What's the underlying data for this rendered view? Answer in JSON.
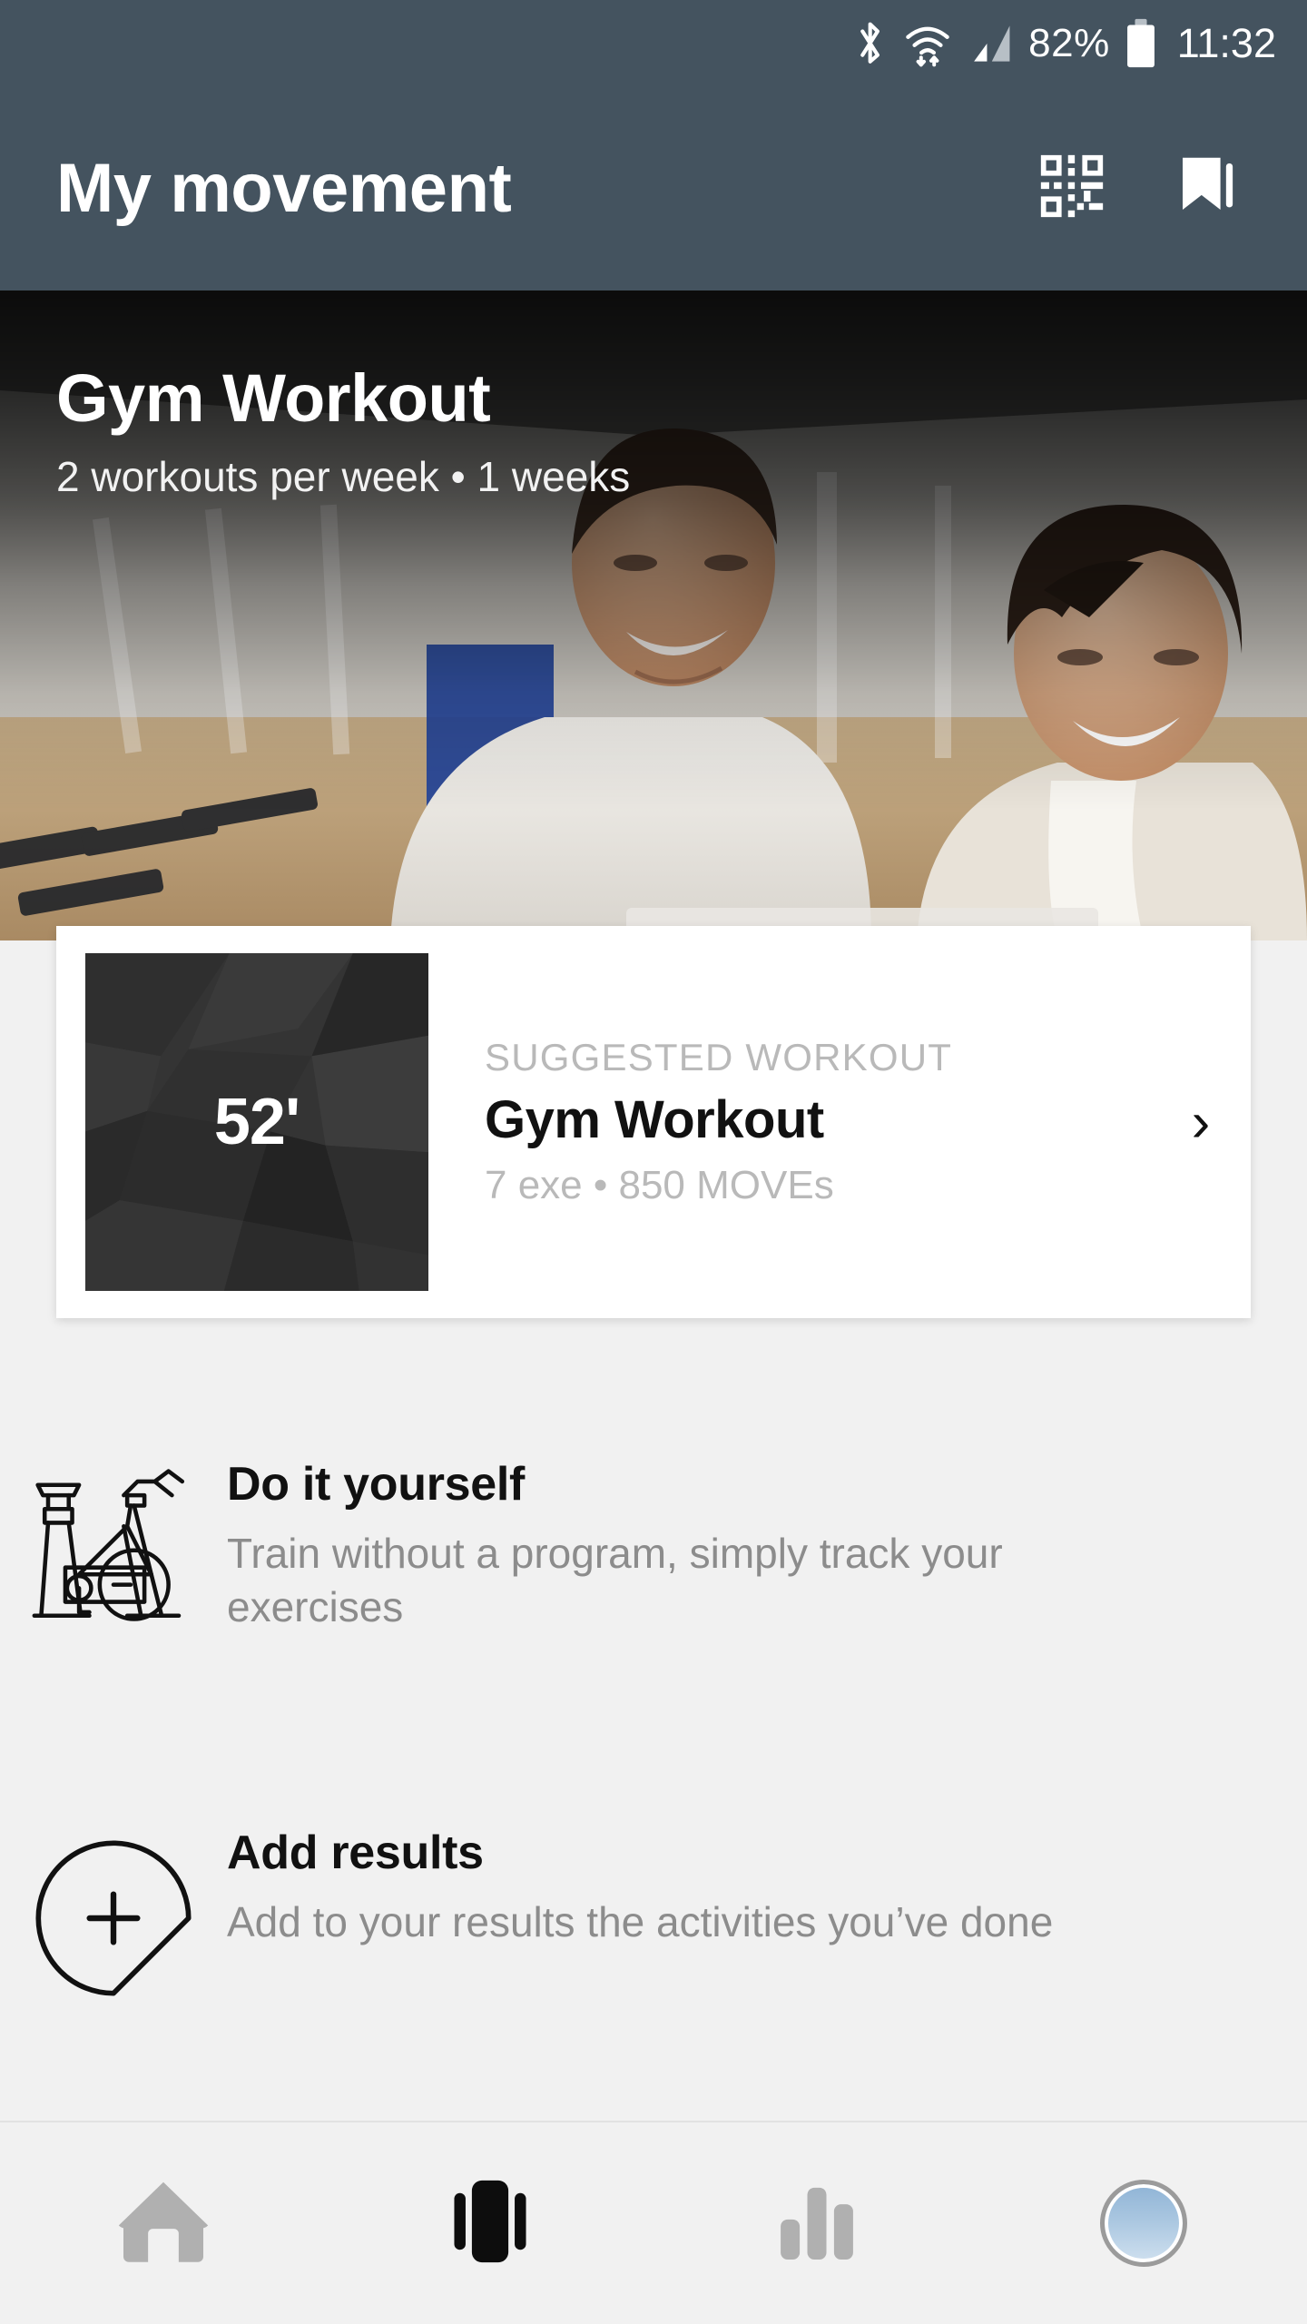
{
  "statusbar": {
    "bluetooth_icon": "bluetooth-icon",
    "wifi_icon": "wifi-icon",
    "signal_icon": "cellular-signal-icon",
    "battery_percent": "82%",
    "battery_icon": "battery-icon",
    "clock": "11:32"
  },
  "appbar": {
    "title": "My movement",
    "scan_icon": "qr-scan-icon",
    "bookmark_icon": "bookmark-icon"
  },
  "hero": {
    "title": "Gym Workout",
    "subtitle": "2 workouts per week • 1 weeks"
  },
  "suggested_card": {
    "duration": "52'",
    "kicker": "SUGGESTED WORKOUT",
    "title": "Gym Workout",
    "meta": "7 exe • 850 MOVEs",
    "chevron": "›"
  },
  "actions": [
    {
      "icon": "exercise-bike-icon",
      "title": "Do it yourself",
      "description": "Train without a program, simply track your exercises"
    },
    {
      "icon": "add-pin-icon",
      "title": "Add results",
      "description": "Add to your results the activities you’ve done"
    }
  ],
  "bottomnav": {
    "items": [
      {
        "icon": "home-icon",
        "active": false
      },
      {
        "icon": "workout-cards-icon",
        "active": true
      },
      {
        "icon": "stats-bars-icon",
        "active": false
      },
      {
        "icon": "profile-avatar-icon",
        "active": false
      }
    ]
  },
  "colors": {
    "header": "#44535f",
    "background": "#f1f1f1",
    "card": "#ffffff",
    "muted_text": "#8c8c8c",
    "kicker_text": "#b9b9b9",
    "primary_text": "#111111",
    "nav_inactive": "#b0b0b0",
    "nav_active": "#111111"
  }
}
